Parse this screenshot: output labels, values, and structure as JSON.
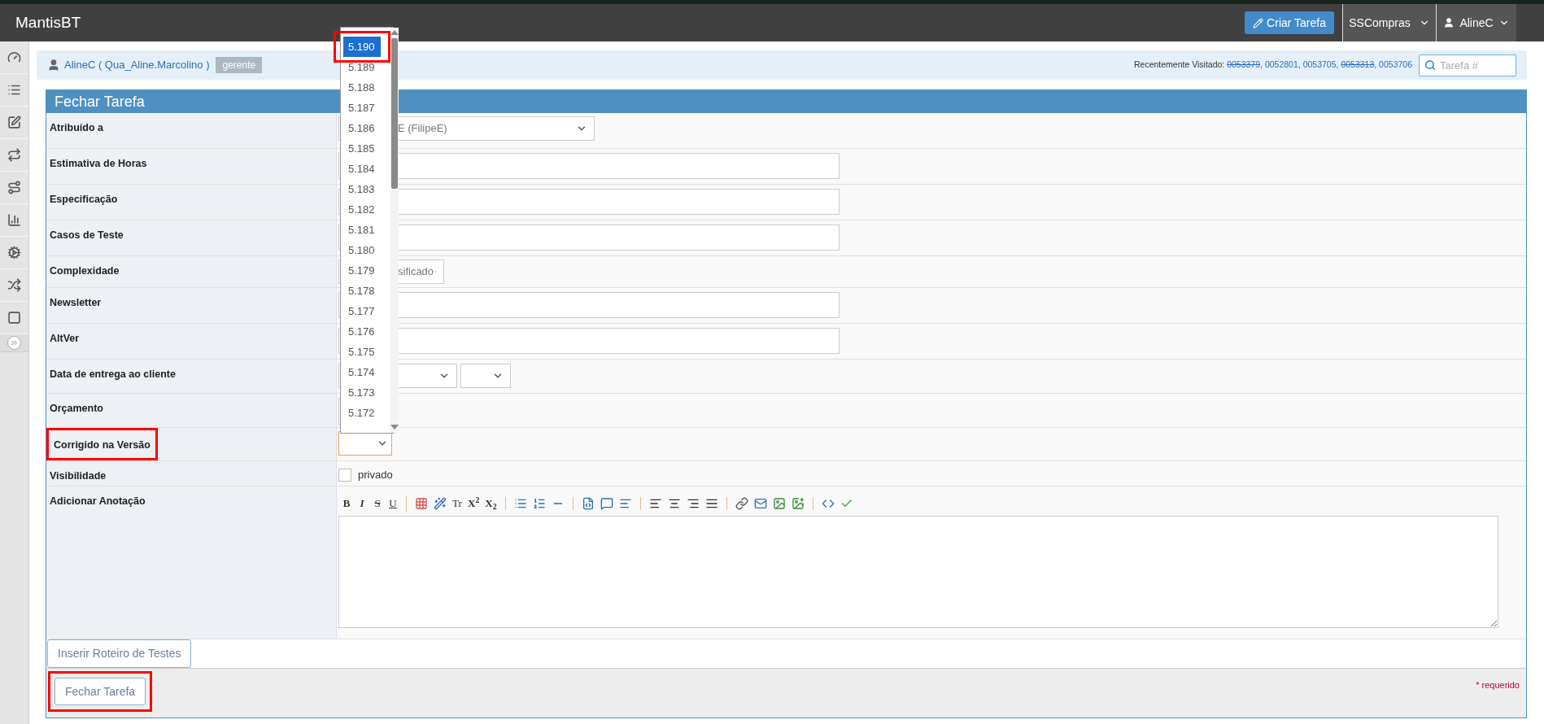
{
  "navbar": {
    "brand": "MantisBT",
    "create_button": "Criar Tarefa",
    "project": "SSCompras",
    "user": "AlineC"
  },
  "sidebar": {
    "items": [
      {
        "selected": false
      },
      {
        "selected": false
      },
      {
        "selected": false
      },
      {
        "selected": false
      },
      {
        "selected": false
      },
      {
        "selected": false
      },
      {
        "selected": false
      },
      {
        "selected": false
      },
      {
        "selected": false
      }
    ]
  },
  "breadcrumb": {
    "user": "AlineC ( Qua_Aline.Marcolino )",
    "role": "gerente",
    "recent_label": "Recentemente Visitado:",
    "recent": [
      {
        "id": "0053379",
        "closed": true,
        "suffix": ","
      },
      {
        "id": "0052801",
        "closed": false,
        "suffix": ","
      },
      {
        "id": "0053705",
        "closed": false,
        "suffix": ","
      },
      {
        "id": "0053313",
        "closed": true,
        "suffix": ","
      },
      {
        "id": "0053706",
        "closed": false
      }
    ],
    "search_placeholder": "Tarefa #"
  },
  "form": {
    "title": "Fechar Tarefa",
    "rows": [
      {
        "label": "Atribuído a",
        "kind": "wide-select",
        "value": "E (FilipeE)",
        "highlighted": false
      },
      {
        "label": "Estimativa de Horas",
        "kind": "input",
        "highlighted": false
      },
      {
        "label": "Especificação",
        "kind": "input",
        "highlighted": false
      },
      {
        "label": "Casos de Teste",
        "kind": "input",
        "highlighted": false
      },
      {
        "label": "Complexidade",
        "kind": "short-select",
        "value": "sificado",
        "highlighted": false
      },
      {
        "label": "Newsletter",
        "kind": "input",
        "highlighted": false
      },
      {
        "label": "AltVer",
        "kind": "input",
        "highlighted": false
      },
      {
        "label": "Data de entrega ao cliente",
        "kind": "date",
        "highlighted": false
      },
      {
        "label": "Orçamento",
        "kind": "small-input",
        "highlighted": false
      },
      {
        "label": "Corrigido na Versão",
        "kind": "version",
        "focused": true,
        "highlighted": true
      },
      {
        "label": "Visibilidade",
        "kind": "checkbox",
        "option": "privado",
        "checked": false,
        "highlighted": false
      },
      {
        "label": "Adicionar Anotação",
        "kind": "editor",
        "highlighted": false
      }
    ],
    "editor_toolbar": [
      [
        {
          "kind": "text",
          "label": "B"
        },
        {
          "kind": "text",
          "label": "I"
        },
        {
          "kind": "text",
          "label": "S"
        },
        {
          "kind": "text",
          "label": "U"
        }
      ],
      [
        {
          "kind": "icon"
        },
        {
          "kind": "icon"
        },
        {
          "kind": "text",
          "label": "Tr"
        },
        {
          "kind": "text",
          "label": "X$^{2}$"
        },
        {
          "kind": "text",
          "label": "X$_{2}$"
        }
      ],
      [
        {
          "kind": "icon"
        },
        {
          "kind": "icon"
        },
        {
          "kind": "icon"
        }
      ],
      [
        {
          "kind": "icon"
        },
        {
          "kind": "icon"
        },
        {
          "kind": "icon"
        }
      ],
      [
        {
          "kind": "icon"
        },
        {
          "kind": "icon"
        },
        {
          "kind": "icon"
        },
        {
          "kind": "icon"
        }
      ],
      [
        {
          "kind": "icon"
        },
        {
          "kind": "icon"
        },
        {
          "kind": "icon"
        },
        {
          "kind": "icon"
        }
      ],
      [
        {
          "kind": "icon"
        },
        {
          "kind": "icon"
        }
      ]
    ],
    "insert_button": "Inserir Roteiro de Testes",
    "submit_button": {
      "label": "Fechar Tarefa",
      "highlighted": true
    },
    "required_note": "* requerido"
  },
  "version_dropdown": {
    "items": [
      {
        "label": "5.190",
        "selected": true,
        "highlighted": true
      },
      {
        "label": "5.189",
        "selected": false,
        "highlighted": false
      },
      {
        "label": "5.188",
        "selected": false,
        "highlighted": false
      },
      {
        "label": "5.187",
        "selected": false,
        "highlighted": false
      },
      {
        "label": "5.186",
        "selected": false,
        "highlighted": false
      },
      {
        "label": "5.185",
        "selected": false,
        "highlighted": false
      },
      {
        "label": "5.184",
        "selected": false,
        "highlighted": false
      },
      {
        "label": "5.183",
        "selected": false,
        "highlighted": false
      },
      {
        "label": "5.182",
        "selected": false,
        "highlighted": false
      },
      {
        "label": "5.181",
        "selected": false,
        "highlighted": false
      },
      {
        "label": "5.180",
        "selected": false,
        "highlighted": false
      },
      {
        "label": "5.179",
        "selected": false,
        "highlighted": false
      },
      {
        "label": "5.178",
        "selected": false,
        "highlighted": false
      },
      {
        "label": "5.177",
        "selected": false,
        "highlighted": false
      },
      {
        "label": "5.176",
        "selected": false,
        "highlighted": false
      },
      {
        "label": "5.175",
        "selected": false,
        "highlighted": false
      },
      {
        "label": "5.174",
        "selected": false,
        "highlighted": false
      },
      {
        "label": "5.173",
        "selected": false,
        "highlighted": false
      },
      {
        "label": "5.172",
        "selected": false,
        "highlighted": false
      }
    ]
  }
}
